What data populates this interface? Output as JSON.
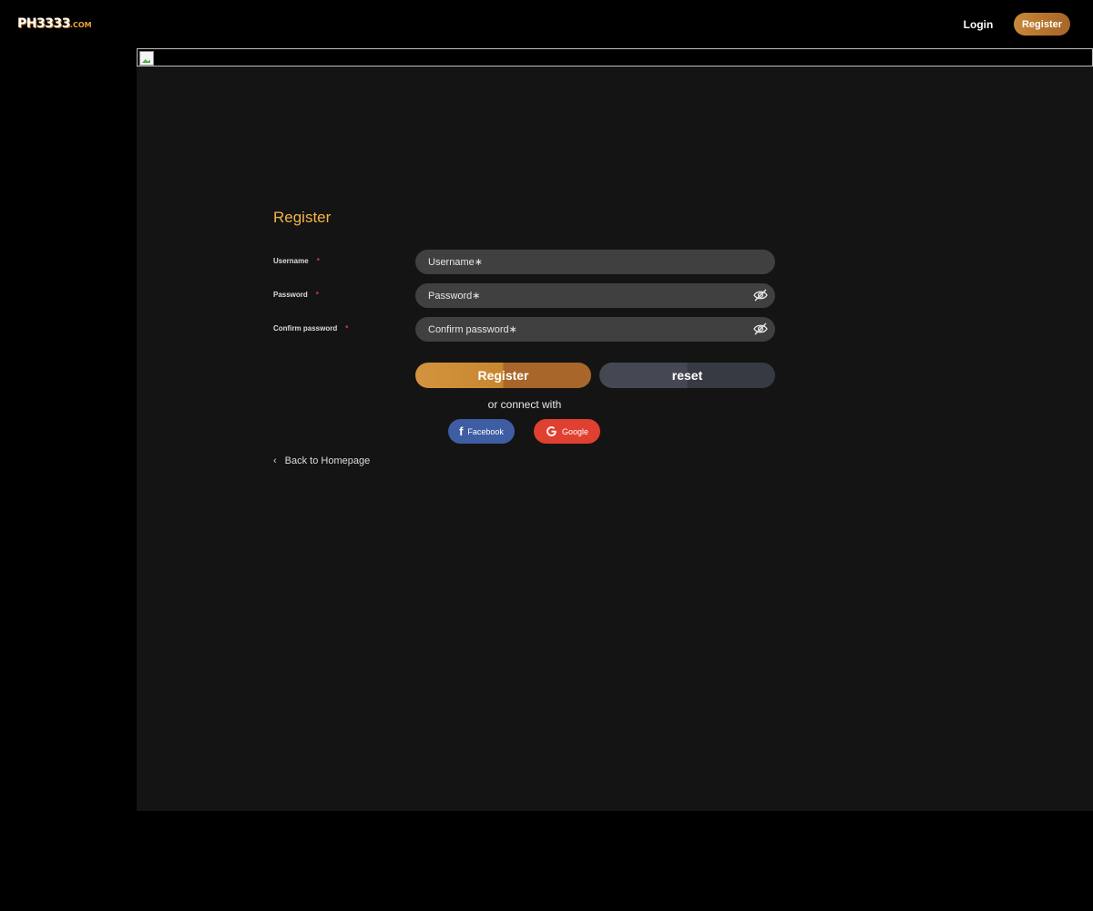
{
  "header": {
    "logo_text": "PH3333",
    "logo_suffix": ".COM",
    "login_label": "Login",
    "register_label": "Register"
  },
  "form": {
    "title": "Register",
    "fields": [
      {
        "label": "Username",
        "required_mark": "*",
        "placeholder": "Username∗",
        "value": ""
      },
      {
        "label": "Password",
        "required_mark": "*",
        "placeholder": "Password∗",
        "value": ""
      },
      {
        "label": "Confirm password",
        "required_mark": "*",
        "placeholder": "Confirm password∗",
        "value": ""
      }
    ],
    "submit_label": "Register",
    "reset_label": "reset",
    "connect_text": "or connect with",
    "social": {
      "facebook_label": "Facebook",
      "google_label": "Google"
    },
    "back_label": "Back to Homepage"
  },
  "colors": {
    "accent": "#c8893b",
    "title": "#f0b445",
    "page_bg": "#000000",
    "panel_bg": "#141414",
    "input_bg": "#404040",
    "facebook": "#3f5da3",
    "google": "#e0402f"
  },
  "icons": [
    "eye-off-icon",
    "facebook-icon",
    "google-icon",
    "chevron-left-icon",
    "broken-image-icon"
  ]
}
